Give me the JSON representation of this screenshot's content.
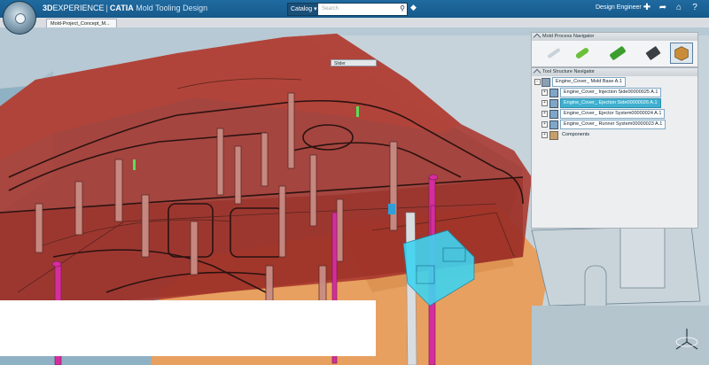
{
  "topbar": {
    "brand_3d": "3D",
    "brand_experience": "EXPERIENCE",
    "brand_separator": "|",
    "brand_catia": "CATIA",
    "app_name": "Mold Tooling Design",
    "search_scope": "Catalog",
    "search_placeholder": "Search",
    "user_name": "Design Engineer",
    "icons": [
      "tag-icon",
      "add-icon",
      "share-icon",
      "home-icon",
      "help-icon"
    ]
  },
  "document_tab": {
    "label": "Mold-Project_Concept_M..."
  },
  "process_navigator": {
    "title": "Mold Process Navigator",
    "tools": [
      "pin-tool-icon",
      "cylinder-tool-icon",
      "plate-tool-icon",
      "block-tool-icon",
      "assembly-box-icon"
    ]
  },
  "tree_navigator": {
    "title": "Tool Structure Navigator",
    "nodes": [
      {
        "label": "Engine_Cover_ Mold Base A.1",
        "style": "normal"
      },
      {
        "label": "Engine_Cover_ Injection Side00000025 A.1",
        "style": "normal"
      },
      {
        "label": "Engine_Cover_ Ejection Side00000026 A.1",
        "style": "selected"
      },
      {
        "label": "Engine_Cover_ Ejector System00000024 A.1",
        "style": "normal"
      },
      {
        "label": "Engine_Cover_ Runner System00000023 A.1",
        "style": "normal"
      },
      {
        "label": "Components",
        "style": "plain"
      }
    ]
  },
  "floating_toolbar": {
    "label": "Slider"
  },
  "colors": {
    "topbar": "#1f6aa0",
    "mold_red": "#a8352c",
    "plate_orange": "#e7a060",
    "cyan_part": "#40d4f0",
    "magenta_pin": "#d42e9c",
    "background": "#8fb1c4"
  }
}
